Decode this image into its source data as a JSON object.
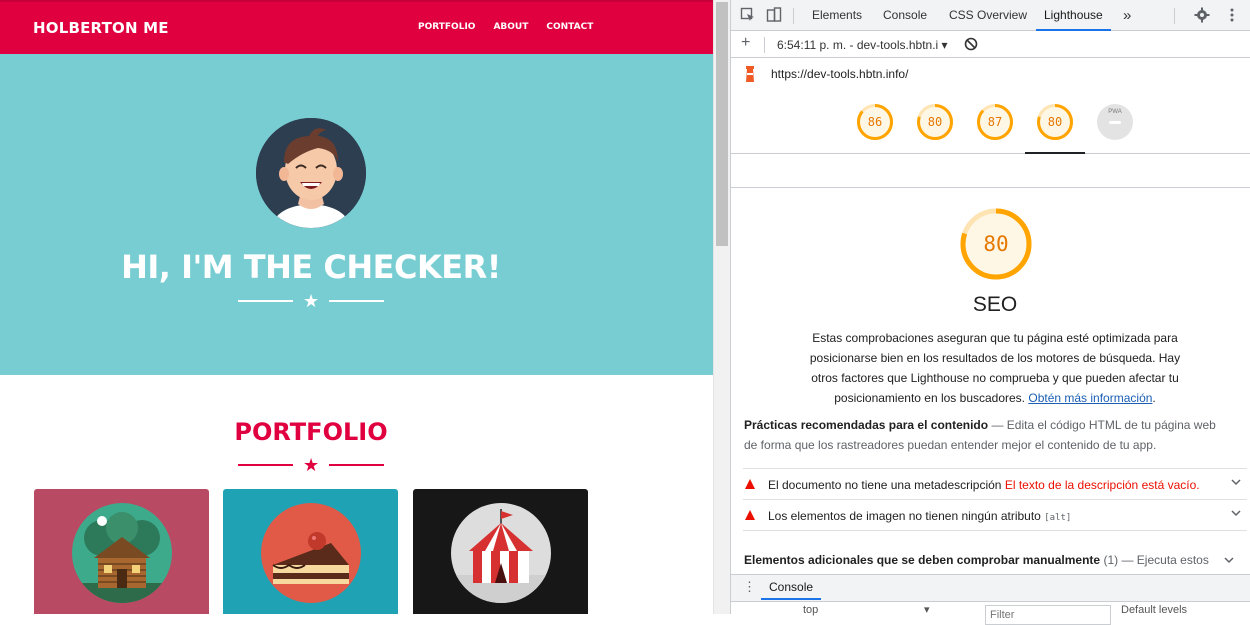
{
  "site": {
    "brand": "HOLBERTON ME",
    "nav": [
      "PORTFOLIO",
      "ABOUT",
      "CONTACT"
    ],
    "hero_title": "HI, I'M THE CHECKER!",
    "portfolio_title": "PORTFOLIO",
    "colors": {
      "primary": "#e0003f",
      "hero_bg": "#78cdd3"
    },
    "cards": [
      {
        "bg": "#b94a63",
        "icon": "cabin-icon"
      },
      {
        "bg": "#1fa3b4",
        "icon": "cake-slice-icon"
      },
      {
        "bg": "#171717",
        "icon": "circus-tent-icon"
      }
    ]
  },
  "devtools": {
    "tabs": [
      "Elements",
      "Console",
      "CSS Overview",
      "Lighthouse"
    ],
    "active_tab": "Lighthouse",
    "report_label": "6:54:11 p. m. - dev-tools.hbtn.i",
    "url": "https://dev-tools.hbtn.info/",
    "scores": [
      "86",
      "80",
      "87",
      "80"
    ],
    "pwa_label": "PWA",
    "seo": {
      "score": "80",
      "score_value": 80,
      "title": "SEO",
      "description": "Estas comprobaciones aseguran que tu página esté optimizada para posicionarse bien en los resultados de los motores de búsqueda. Hay otros factores que Lighthouse no comprueba y que pueden afectar tu posicionamiento en los buscadores.",
      "learn_more": "Obtén más información",
      "after_link": "."
    },
    "practices": {
      "heading": "Prácticas recomendadas para el contenido",
      "dash": " — ",
      "text": "Edita el código HTML de tu página web de forma que los rastreadores puedan entender mejor el contenido de tu app."
    },
    "audits": [
      {
        "label": "El documento no tiene una metadescripción",
        "detail": "El texto de la descripción está vacío."
      },
      {
        "label": "Los elementos de imagen no tienen ningún atributo",
        "code": "[alt]"
      }
    ],
    "manual": {
      "heading": "Elementos adicionales que se deben comprobar manualmente",
      "count": "(1)",
      "dash": " — ",
      "text": "Ejecuta estos"
    },
    "drawer": {
      "tab": "Console",
      "context": "top",
      "filter_placeholder": "Filter",
      "levels": "Default levels"
    }
  }
}
